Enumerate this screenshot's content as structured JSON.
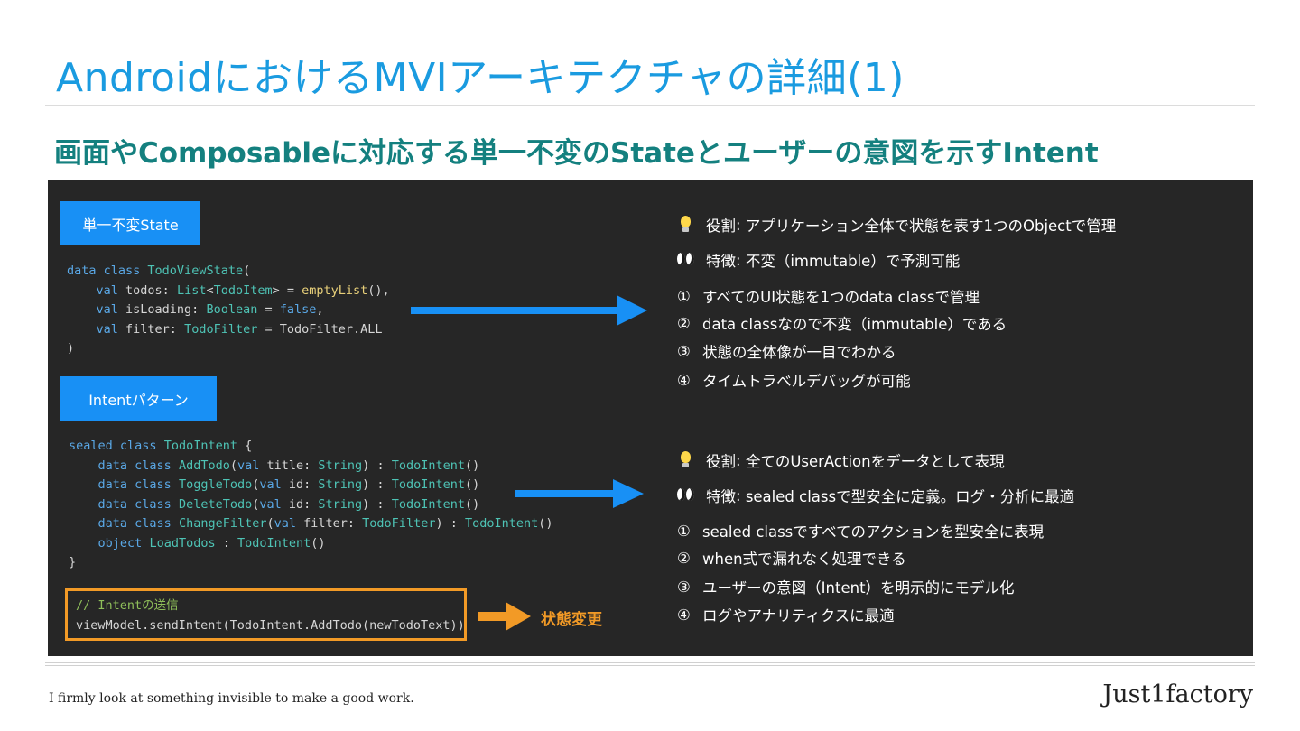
{
  "title": "AndroidにおけるMVIアーキテクチャの詳細(1)",
  "subtitle": "画面やComposableに対応する単一不変のStateとユーザーの意図を示すIntent",
  "state_section": {
    "tag": "単一不変State",
    "code": [
      [
        "data class TodoViewState("
      ],
      [
        "    val todos: List<TodoItem> = emptyList(),"
      ],
      [
        "    val isLoading: Boolean = false,"
      ],
      [
        "    val filter: TodoFilter = TodoFilter.ALL"
      ],
      [
        ")"
      ]
    ],
    "role_label": "役割",
    "role_text": "アプリケーション全体で状態を表す1つのObjectで管理",
    "feature_label": "特徴",
    "feature_text": "不変（immutable）で予測可能",
    "points": [
      {
        "num": "①",
        "text": "すべてのUI状態を1つのdata classで管理"
      },
      {
        "num": "②",
        "text": "data classなので不変（immutable）である"
      },
      {
        "num": "③",
        "text": "状態の全体像が一目でわかる"
      },
      {
        "num": "④",
        "text": "タイムトラベルデバッグが可能"
      }
    ]
  },
  "intent_section": {
    "tag": "Intentパターン",
    "role_label": "役割",
    "role_text": "全てのUserActionをデータとして表現",
    "feature_label": "特徴",
    "feature_text": "sealed classで型安全に定義。ログ・分析に最適",
    "points": [
      {
        "num": "①",
        "text": "sealed classですべてのアクションを型安全に表現"
      },
      {
        "num": "②",
        "text": "when式で漏れなく処理できる"
      },
      {
        "num": "③",
        "text": "ユーザーの意図（Intent）を明示的にモデル化"
      },
      {
        "num": "④",
        "text": "ログやアナリティクスに最適"
      }
    ]
  },
  "send": {
    "comment": "// Intentの送信",
    "code": "viewModel.sendIntent(TodoIntent.AddTodo(newTodoText))"
  },
  "state_change": "状態変更",
  "footer": {
    "tagline": "I firmly look at something invisible to make a good work.",
    "brand": "Just1factory"
  },
  "colors": {
    "title": "#1a9be0",
    "subtitle": "#14807f",
    "panel": "#262626",
    "tag": "#1890f5",
    "arrow_blue": "#1890f5",
    "accent_orange": "#f29a26"
  }
}
